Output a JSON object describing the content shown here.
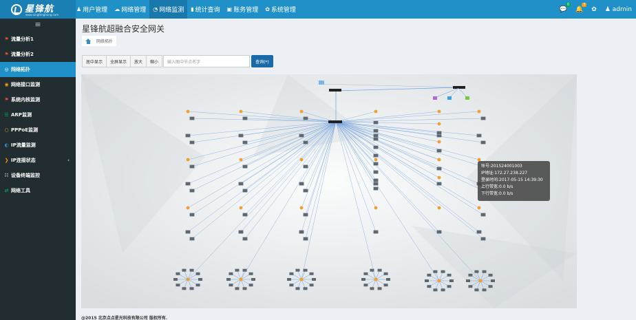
{
  "app": {
    "logo_text": "星锋航",
    "logo_sub": "www.xingfenghang.com"
  },
  "topnav": [
    {
      "label": "用户管理",
      "icon": "users-icon",
      "glyph": "♟"
    },
    {
      "label": "网络管理",
      "icon": "cloud-icon",
      "glyph": "☁"
    },
    {
      "label": "网络监测",
      "icon": "dashboard-icon",
      "glyph": "◔"
    },
    {
      "label": "统计查询",
      "icon": "bar-chart-icon",
      "glyph": "▮"
    },
    {
      "label": "账务管理",
      "icon": "money-icon",
      "glyph": "▣"
    },
    {
      "label": "系统管理",
      "icon": "gear-icon",
      "glyph": "✿"
    }
  ],
  "topright": {
    "msg_badge": "0",
    "bell_badge": "3",
    "user": "admin"
  },
  "sidebar": [
    {
      "label": "流量分析1",
      "icon": "flag-icon",
      "color": "#dd4b39",
      "glyph": "⚑"
    },
    {
      "label": "流量分析2",
      "icon": "flag-icon",
      "color": "#dd4b39",
      "glyph": "⚑"
    },
    {
      "label": "网络拓扑",
      "icon": "topology-icon",
      "color": "#3c8dbc",
      "glyph": "◎"
    },
    {
      "label": "网络接口监测",
      "icon": "eye-icon",
      "color": "#f39c12",
      "glyph": "◉"
    },
    {
      "label": "系统内核监测",
      "icon": "flag-icon",
      "color": "#dd4b39",
      "glyph": "⚑"
    },
    {
      "label": "ARP监测",
      "icon": "list-icon",
      "color": "#00a65a",
      "glyph": "☰"
    },
    {
      "label": "PPPoE监测",
      "icon": "circle-icon",
      "color": "#f39c12",
      "glyph": "○"
    },
    {
      "label": "IP流量监测",
      "icon": "globe-icon",
      "color": "#3c8dbc",
      "glyph": "◐"
    },
    {
      "label": "IP连接状态",
      "icon": "chevron-icon",
      "color": "#f39c12",
      "glyph": "❯"
    },
    {
      "label": "设备终端监控",
      "icon": "list-icon",
      "color": "#b8c7ce",
      "glyph": "☷"
    },
    {
      "label": "网络工具",
      "icon": "swap-icon",
      "color": "#00a65a",
      "glyph": "⇄"
    }
  ],
  "page": {
    "title": "星锋航超融合安全网关",
    "breadcrumb": "网络拓扑"
  },
  "toolbar": {
    "buttons": [
      "居中显示",
      "全屏显示",
      "放大",
      "缩小"
    ],
    "search_placeholder": "输入图中节点名字",
    "query_label": "查询(*)"
  },
  "tooltip": {
    "account": "账号:201524001003",
    "ip": "IP地址:172.27.238.227",
    "login": "登录时间:2017-05-15 14:39:30",
    "up": "上行带宽:0.0 b/s",
    "down": "下行带宽:0.0 b/s"
  },
  "footer": "@2015 北京点点星光科技有限公司 版权所有."
}
